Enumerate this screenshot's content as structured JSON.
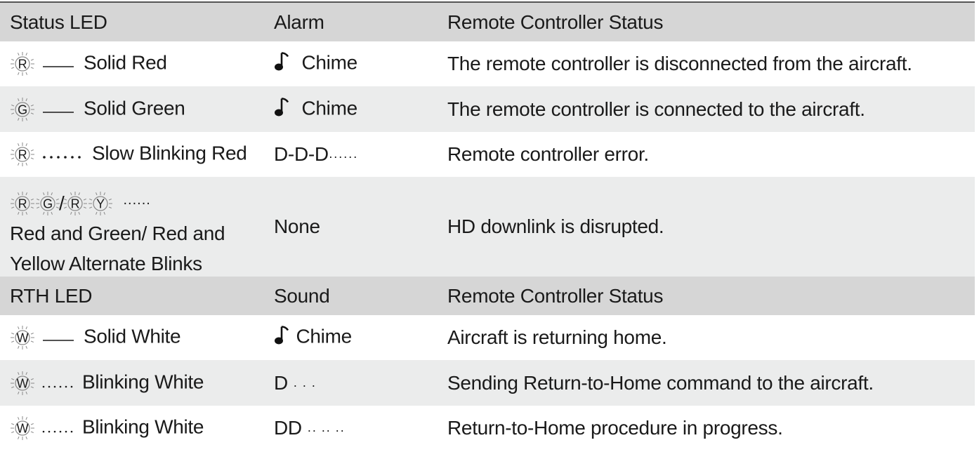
{
  "sections": [
    {
      "header": {
        "led": "Status LED",
        "sound": "Alarm",
        "status": "Remote Controller Status"
      },
      "rows": [
        {
          "led_letters": [
            "R"
          ],
          "pattern": "solid",
          "led_label": "Solid Red",
          "sound_icon": "music-note-icon",
          "sound": "Chime",
          "status": "The remote controller is disconnected from the aircraft."
        },
        {
          "led_letters": [
            "G"
          ],
          "pattern": "solid",
          "led_label": "Solid Green",
          "sound_icon": "music-note-icon",
          "sound": "Chime",
          "status": "The remote controller is connected to the aircraft."
        },
        {
          "led_letters": [
            "R"
          ],
          "pattern": "dotted",
          "led_label": "Slow Blinking Red",
          "sound": "D-D-D",
          "sound_suffix": "······",
          "status": "Remote controller error."
        },
        {
          "led_letters": [
            "R",
            "G",
            "/",
            "R",
            "Y"
          ],
          "pattern_text": "......",
          "led_label_line1": "Red and Green/ Red and",
          "led_label_line2": "Yellow Alternate Blinks",
          "sound": "None",
          "status": "HD downlink is disrupted."
        }
      ]
    },
    {
      "header": {
        "led": "RTH LED",
        "sound": "Sound",
        "status": "Remote Controller Status"
      },
      "rows": [
        {
          "led_letters": [
            "W"
          ],
          "pattern": "solid",
          "led_label": "Solid White",
          "sound_icon": "music-note-icon",
          "sound": "Chime",
          "status": "Aircraft is returning home."
        },
        {
          "led_letters": [
            "W"
          ],
          "pattern": "dotted-small",
          "led_label": "Blinking White",
          "sound": "D",
          "sound_suffix": "· · ·",
          "status": "Sending Return-to-Home command to the aircraft."
        },
        {
          "led_letters": [
            "W"
          ],
          "pattern": "dotted-small",
          "led_label": "Blinking White",
          "sound": "DD",
          "sound_suffix": "·· ·· ··",
          "status": "Return-to-Home procedure in progress."
        }
      ]
    }
  ],
  "colors": {
    "header_bg": "#d6d6d6",
    "alt_row_bg": "#ebecec",
    "text": "#1a1a1a",
    "led_ring": "#888888"
  }
}
